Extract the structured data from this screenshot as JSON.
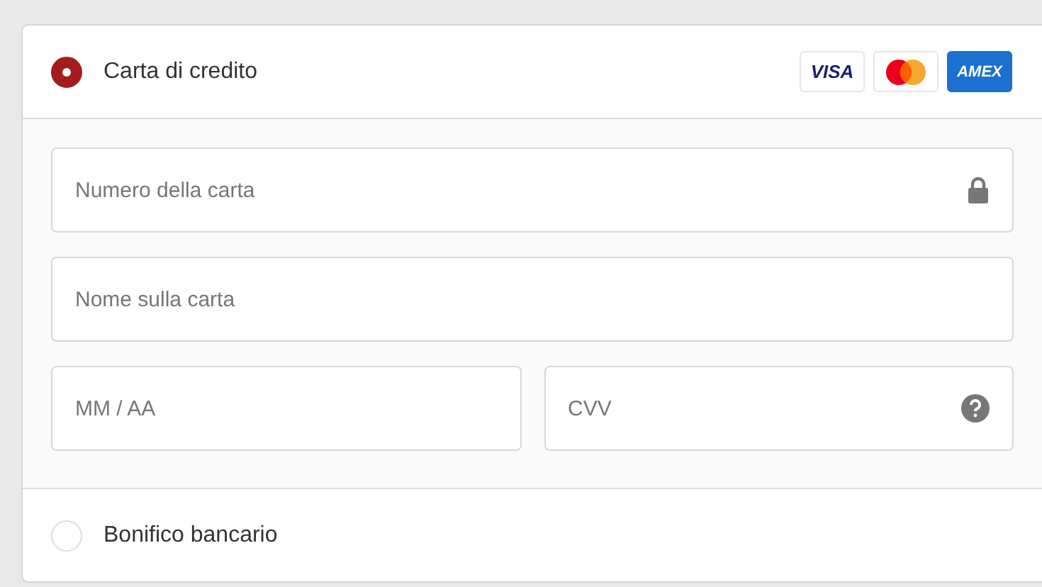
{
  "payment_methods": [
    {
      "label": "Carta di credito",
      "selected": true,
      "brands": [
        {
          "kind": "visa",
          "text": "VISA"
        },
        {
          "kind": "mastercard"
        },
        {
          "kind": "amex",
          "text": "AMEX"
        }
      ],
      "fields": [
        {
          "kind": "number",
          "placeholder": "Numero della carta"
        },
        {
          "kind": "name",
          "placeholder": "Nome sulla carta"
        },
        {
          "kind": "expiry",
          "placeholder": "MM / AA"
        },
        {
          "kind": "cvv",
          "placeholder": "CVV"
        }
      ]
    },
    {
      "label": "Bonifico bancario",
      "selected": false
    }
  ]
}
